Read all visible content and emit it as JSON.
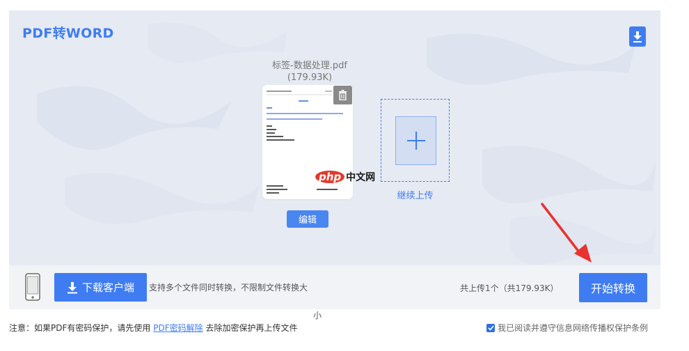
{
  "header": {
    "title": "PDF转WORD",
    "download_icon": "download-icon"
  },
  "file": {
    "name": "标签-数据处理.pdf",
    "size": "(179.93K)",
    "delete_icon": "trash-icon",
    "edit_label": "编辑"
  },
  "watermark": {
    "php": "php",
    "text": "中文网"
  },
  "add_more": {
    "label": "继续上传",
    "icon": "plus-icon"
  },
  "bottom_bar": {
    "phone_icon": "phone-icon",
    "client_button": "下载客户端",
    "client_icon": "download-icon",
    "support_text_line1": "支持多个文件同时转换，不限制文件转换大",
    "support_text_line2": "小",
    "total_text": "共上传1个（共179.93K）",
    "start_button": "开始转换"
  },
  "footer": {
    "notice_prefix": "注意：如果PDF有密码保护，请先使用",
    "notice_link": "PDF密码解除",
    "notice_suffix": "去除加密保护再上传文件",
    "agreement_checked": true,
    "agreement_text": "我已阅读并遵守信息网络传播权保护条例"
  },
  "colors": {
    "accent": "#3f7cf1",
    "panel_bg": "#e6eaf3",
    "arrow": "#e8332f"
  }
}
